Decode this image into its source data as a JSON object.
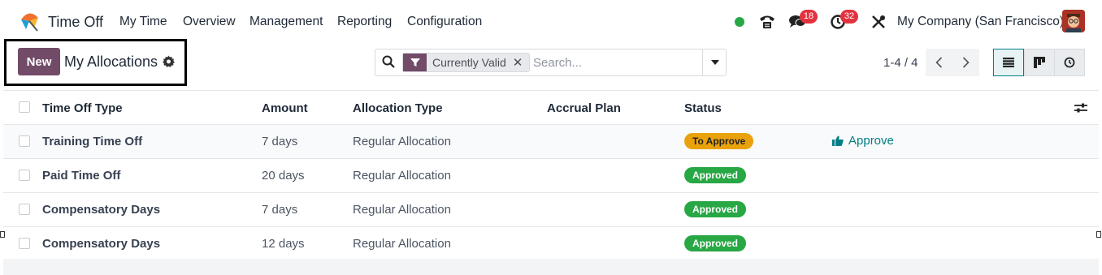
{
  "navbar": {
    "app_name": "Time Off",
    "menu": [
      "My Time",
      "Overview",
      "Management",
      "Reporting",
      "Configuration"
    ],
    "messages_count": "18",
    "activities_count": "32",
    "company": "My Company (San Francisco)",
    "status_color": "#28a745"
  },
  "control_panel": {
    "new_label": "New",
    "title": "My Allocations",
    "facet_label": "Currently Valid",
    "search_placeholder": "Search...",
    "pager": "1-4 / 4"
  },
  "table": {
    "headers": [
      "Time Off Type",
      "Amount",
      "Allocation Type",
      "Accrual Plan",
      "Status"
    ],
    "rows": [
      {
        "type": "Training Time Off",
        "amount": "7 days",
        "allocation_type": "Regular Allocation",
        "accrual_plan": "",
        "status": "To Approve",
        "action": "Approve"
      },
      {
        "type": "Paid Time Off",
        "amount": "20 days",
        "allocation_type": "Regular Allocation",
        "accrual_plan": "",
        "status": "Approved",
        "action": ""
      },
      {
        "type": "Compensatory Days",
        "amount": "7 days",
        "allocation_type": "Regular Allocation",
        "accrual_plan": "",
        "status": "Approved",
        "action": ""
      },
      {
        "type": "Compensatory Days",
        "amount": "12 days",
        "allocation_type": "Regular Allocation",
        "accrual_plan": "",
        "status": "Approved",
        "action": ""
      }
    ]
  },
  "colors": {
    "brand": "#714b67",
    "accent": "#017e84",
    "to_approve": "#e9a20b",
    "approved": "#28a745"
  },
  "icons": [
    "app-logo-icon",
    "phone-icon",
    "chat-icon",
    "clock-icon",
    "tools-icon",
    "gear-icon",
    "search-icon",
    "filter-icon",
    "list-view-icon",
    "kanban-view-icon",
    "activity-view-icon",
    "thumbs-up-icon",
    "sliders-icon"
  ]
}
